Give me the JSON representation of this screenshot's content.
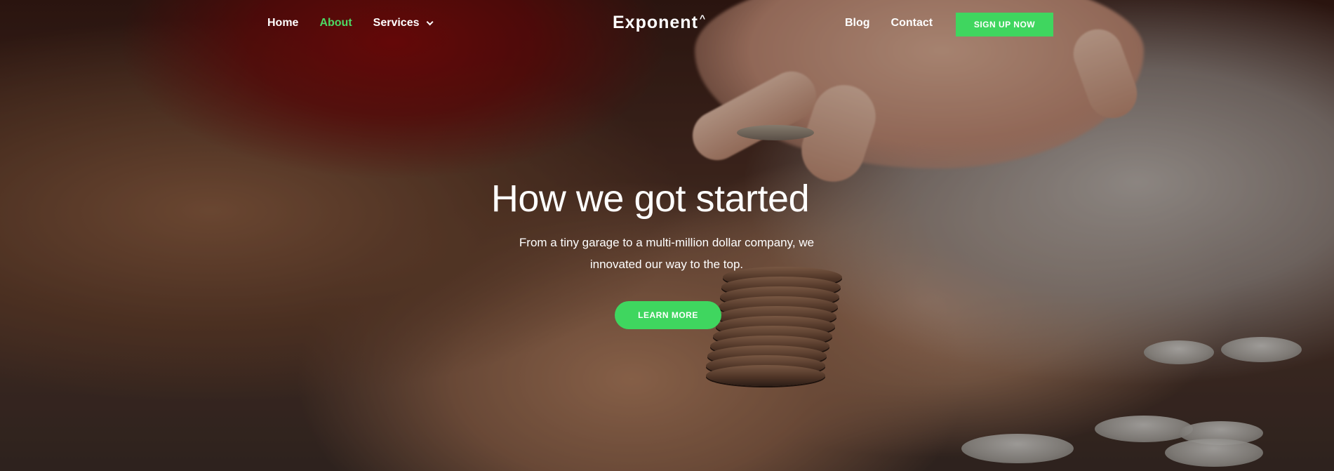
{
  "nav": {
    "left_links": [
      {
        "label": "Home",
        "active": false
      },
      {
        "label": "About",
        "active": true
      },
      {
        "label": "Services",
        "active": false
      }
    ],
    "logo": "Exponent",
    "logo_mark": "^",
    "right_links": [
      {
        "label": "Blog"
      },
      {
        "label": "Contact"
      }
    ],
    "cta_label": "SIGN UP NOW"
  },
  "hero": {
    "title": "How we got started",
    "subtitle": "From a tiny garage to a multi-million dollar company, we innovated our way to the top.",
    "button_label": "LEARN MORE"
  },
  "colors": {
    "accent": "#3fd65f",
    "active_link": "#4cd964",
    "text": "#ffffff"
  }
}
